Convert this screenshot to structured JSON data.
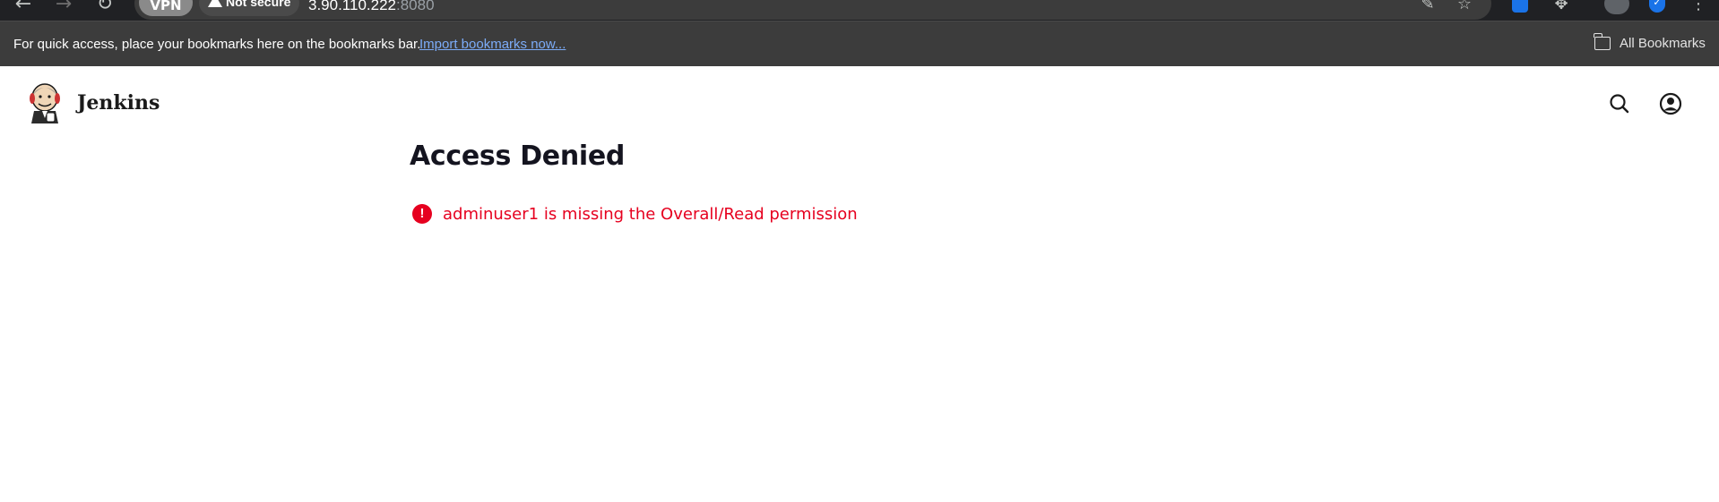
{
  "browser": {
    "vpn_label": "VPN",
    "security_label": "Not secure",
    "url_host": "3.90.110.222",
    "url_port": ":8080",
    "back_icon": "back-arrow-icon",
    "forward_icon": "forward-arrow-icon",
    "reload_icon": "reload-icon"
  },
  "bookmarks_bar": {
    "message": "For quick access, place your bookmarks here on the bookmarks bar.",
    "import_link": "Import bookmarks now...",
    "all_bookmarks": "All Bookmarks"
  },
  "header": {
    "brand": "Jenkins",
    "search_icon": "search-icon",
    "user_icon": "user-account-icon"
  },
  "main": {
    "title": "Access Denied",
    "error_icon_glyph": "!",
    "error_message": "adminuser1 is missing the Overall/Read permission"
  },
  "colors": {
    "error_red": "#e6001f",
    "link_blue": "#7cacf8",
    "chrome_dark": "#202124",
    "bookmarks_bar": "#3c3c3c"
  }
}
